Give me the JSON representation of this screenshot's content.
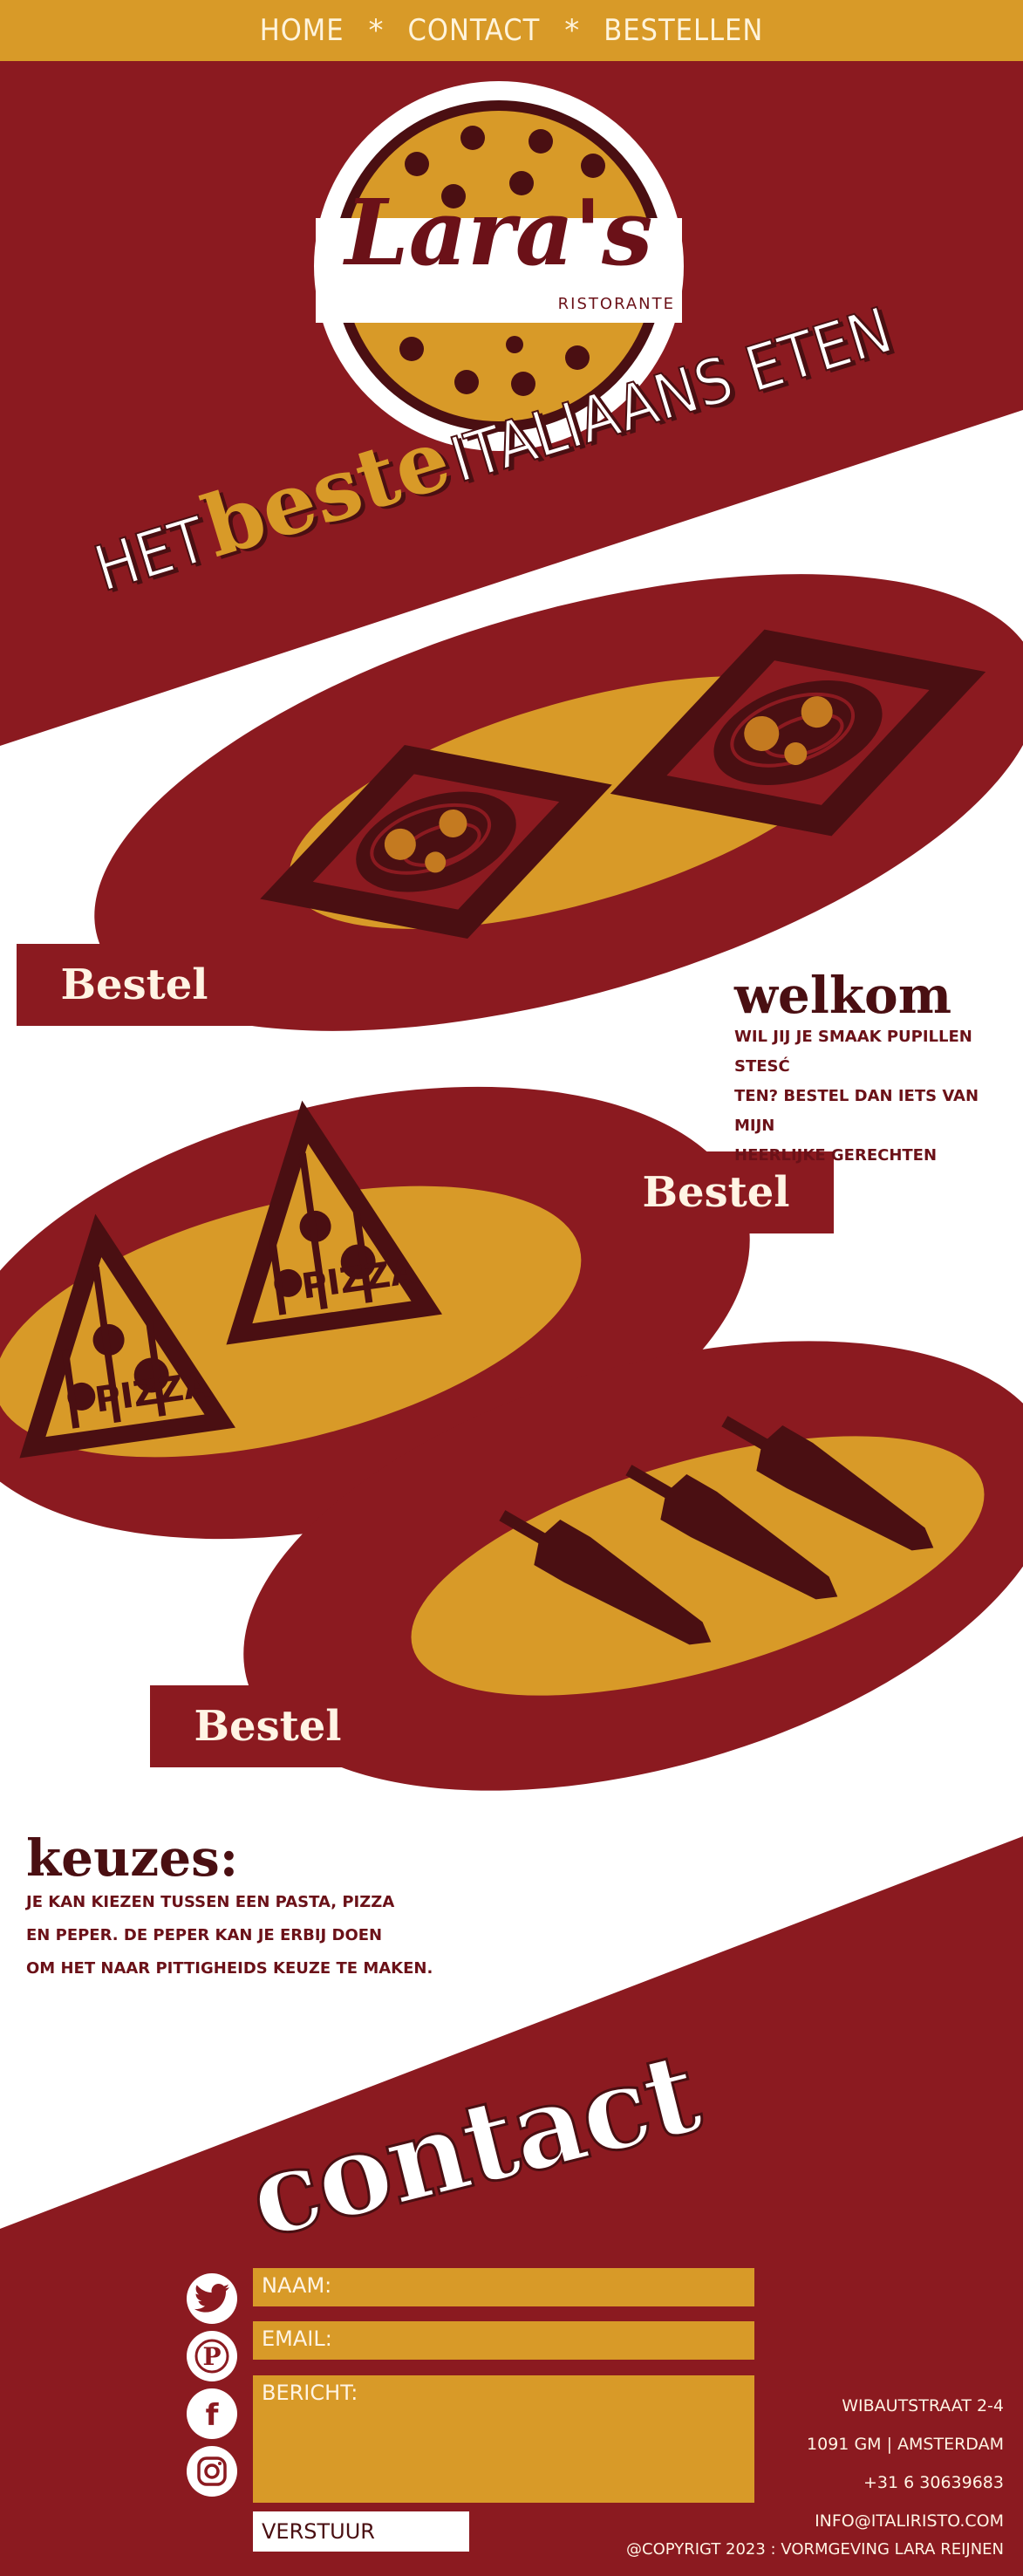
{
  "nav": {
    "items": [
      "HOME",
      "CONTACT",
      "BESTELLEN"
    ],
    "separator": "*"
  },
  "logo": {
    "name": "Lara's",
    "subtitle": "RISTORANTE"
  },
  "hero": {
    "word1": "HET",
    "word2": "beste",
    "word3": "ITALIAANS ETEN"
  },
  "dishes": [
    {
      "type": "pasta",
      "button_label": "Bestel"
    },
    {
      "type": "pizza",
      "button_label": "Bestel",
      "pizza_text": "PIZZA"
    },
    {
      "type": "pepper",
      "button_label": "Bestel"
    }
  ],
  "welkom": {
    "title": "welkom",
    "lines": [
      "WIL JIJ JE SMAAK PUPILLEN STESĆ",
      "TEN? BESTEL DAN IETS VAN MIJN",
      "HEERLIJKE GERECHTEN"
    ]
  },
  "keuzes": {
    "title": "keuzes:",
    "lines": [
      "JE KAN KIEZEN TUSSEN EEN PASTA, PIZZA",
      "EN PEPER. DE PEPER KAN JE ERBIJ DOEN",
      "OM HET NAAR PITTIGHEIDS KEUZE TE MAKEN."
    ]
  },
  "contact": {
    "title": "contact",
    "form": {
      "name_label": "NAAM:",
      "email_label": "EMAIL:",
      "message_label": "BERICHT:",
      "submit_label": "VERSTUUR"
    },
    "social": [
      "twitter-icon",
      "pinterest-icon",
      "facebook-icon",
      "instagram-icon"
    ],
    "address": [
      "WIBAUTSTRAAT 2-4",
      "1091 GM | AMSTERDAM",
      "+31 6 30639683",
      "INFO@ITALIRISTO.COM"
    ],
    "copyright": "@COPYRIGT 2023 : VORMGEVING LARA REIJNEN"
  },
  "colors": {
    "maroon": "#8b1a20",
    "mustard": "#d89a28",
    "dark": "#4a0f12",
    "cream": "#fff4e4"
  }
}
